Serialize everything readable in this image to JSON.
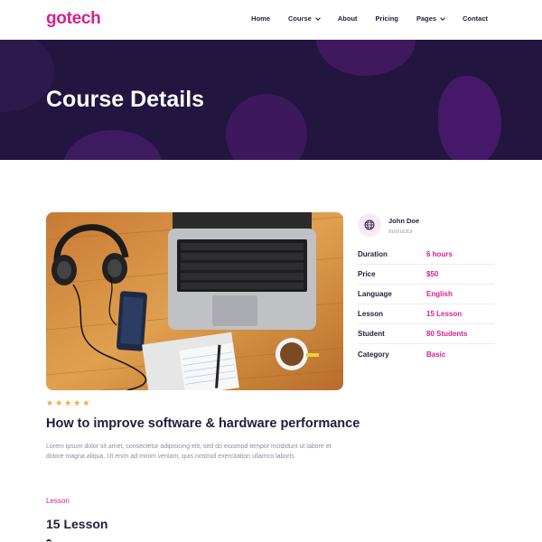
{
  "header": {
    "logo": "gotech",
    "nav": [
      {
        "label": "Home",
        "dropdown": false
      },
      {
        "label": "Course",
        "dropdown": true
      },
      {
        "label": "About",
        "dropdown": false
      },
      {
        "label": "Pricing",
        "dropdown": false
      },
      {
        "label": "Pages",
        "dropdown": true
      },
      {
        "label": "Contact",
        "dropdown": false
      }
    ]
  },
  "hero": {
    "title": "Course Details"
  },
  "course": {
    "rating": 5,
    "title": "How to improve software & hardware performance",
    "description": "Lorem ipsum dolor sit amet, consectetur adipisicing elit, sed do eiusmod tempor incididunt ut labore et dolore magna aliqua. Ut enim ad minim veniam, quis nostrud exercitation ullamco laboris"
  },
  "section": {
    "label": "Lesson",
    "heading": "15 Lesson"
  },
  "instructor": {
    "name": "John Doe",
    "role": "Instructor",
    "icon": "globe-icon"
  },
  "info": [
    {
      "key": "Duration",
      "value": "6 hours"
    },
    {
      "key": "Price",
      "value": "$50"
    },
    {
      "key": "Language",
      "value": "English"
    },
    {
      "key": "Lesson",
      "value": "15 Lesson"
    },
    {
      "key": "Student",
      "value": "80 Students"
    },
    {
      "key": "Category",
      "value": "Basic"
    }
  ],
  "colors": {
    "accent": "#d6208e",
    "hero_bg": "#22153f",
    "heading": "#1f1d3d",
    "star": "#f2a93b"
  }
}
